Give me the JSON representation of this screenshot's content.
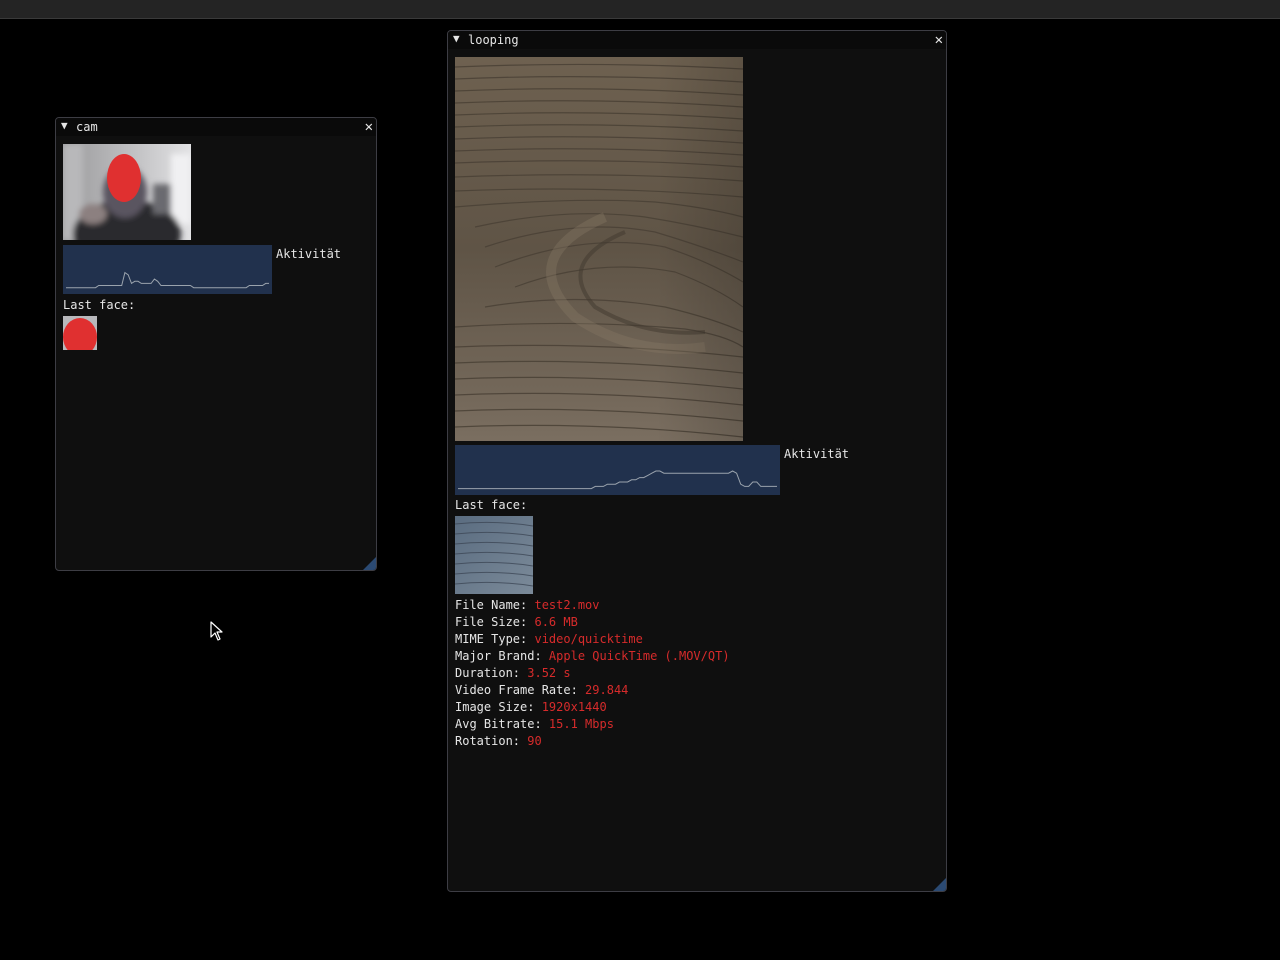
{
  "cam_window": {
    "title": "cam",
    "activity_label": "Aktivität",
    "last_face_label": "Last face:",
    "activity_plot": [
      2,
      2,
      2,
      2,
      2,
      2,
      2,
      2,
      2,
      2,
      3,
      3,
      3,
      3,
      3,
      3,
      3,
      3,
      9,
      8,
      4,
      5,
      5,
      4,
      4,
      4,
      4,
      6,
      5,
      3,
      3,
      3,
      3,
      3,
      3,
      3,
      3,
      3,
      3,
      2,
      2,
      2,
      2,
      2,
      2,
      2,
      2,
      2,
      2,
      2,
      2,
      2,
      2,
      2,
      2,
      2,
      3,
      3,
      3,
      3,
      3,
      4,
      4
    ]
  },
  "looping_window": {
    "title": "looping",
    "activity_label": "Aktivität",
    "last_face_label": "Last face:",
    "activity_plot": [
      2,
      2,
      2,
      2,
      2,
      2,
      2,
      2,
      2,
      2,
      2,
      2,
      2,
      2,
      2,
      2,
      2,
      2,
      2,
      2,
      2,
      2,
      2,
      2,
      2,
      2,
      2,
      2,
      2,
      2,
      2,
      2,
      2,
      2,
      3,
      3,
      3,
      4,
      4,
      4,
      5,
      5,
      5,
      6,
      6,
      7,
      7,
      8,
      9,
      10,
      10,
      9,
      9,
      9,
      9,
      9,
      9,
      9,
      9,
      9,
      9,
      9,
      9,
      9,
      9,
      9,
      9,
      9,
      10,
      9,
      4,
      3,
      3,
      5,
      5,
      3,
      3,
      3,
      3,
      3
    ],
    "info": [
      {
        "key": "File Name: ",
        "value": "test2.mov"
      },
      {
        "key": "File Size: ",
        "value": "6.6 MB"
      },
      {
        "key": "MIME Type: ",
        "value": "video/quicktime"
      },
      {
        "key": "Major Brand: ",
        "value": "Apple QuickTime (.MOV/QT)"
      },
      {
        "key": "Duration: ",
        "value": "3.52 s"
      },
      {
        "key": "Video Frame Rate: ",
        "value": "29.844"
      },
      {
        "key": "Image Size: ",
        "value": "1920x1440"
      },
      {
        "key": "Avg Bitrate: ",
        "value": "15.1 Mbps"
      },
      {
        "key": "Rotation: ",
        "value": "90"
      }
    ]
  },
  "icons": {
    "collapse": "collapse-arrow-icon",
    "close": "close-icon",
    "resize": "resize-grip-icon",
    "cursor": "mouse-cursor-icon"
  },
  "colors": {
    "window_bg": "#0f0f0f",
    "plot_bg": "#21314d",
    "plot_line": "#9aa3ad",
    "value_text": "#d62b2b",
    "face_marker": "#e03030"
  }
}
